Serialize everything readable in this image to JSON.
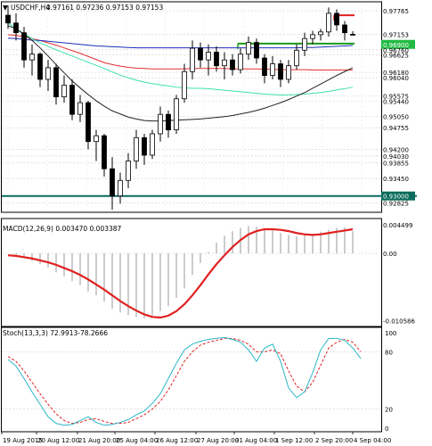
{
  "header": {
    "symbol": "USDCHF,H4",
    "ohlc": "0.97161 0.97236 0.97153 0.97153"
  },
  "colors": {
    "bull_candle": "#ffffff",
    "bear_candle": "#000000",
    "ma_red": "#e53030",
    "ma_blue": "#1a2fb8",
    "ma_cyan": "#3ee0b0",
    "ma_black": "#222222",
    "support_level": "#0b6b5c",
    "resistance_green": "#1a9a1a",
    "resistance_red": "#e02020",
    "macd_signal": "#e02020",
    "macd_hist": "#9a9a9a",
    "stoch_main": "#2ab6c8",
    "stoch_signal": "#e02020",
    "price_tag_fill": "#22bb44",
    "price_tag_dark": "#0b6b5c"
  },
  "chart_data": [
    {
      "type": "candlestick",
      "title": "USDCHF,H4",
      "x_tick_labels": [
        "19 Aug 2015",
        "20 Aug 12:00",
        "21 Aug 20:00",
        "25 Aug 04:00",
        "26 Aug 12:00",
        "27 Aug 20:00",
        "31 Aug 04:00",
        "1 Sep 12:00",
        "2 Sep 20:00",
        "4 Sep 04:00"
      ],
      "y_price_labels": [
        "0.97765",
        "0.97153",
        "0.96900",
        "0.96760",
        "0.96625",
        "0.96180",
        "0.96040",
        "0.95575",
        "0.95440",
        "0.95050",
        "0.94755",
        "0.94200",
        "0.94030",
        "0.93855",
        "0.93450",
        "0.93000",
        "0.92825"
      ],
      "ylim": [
        0.9258,
        0.9795
      ],
      "candles": [
        {
          "o": 0.9765,
          "h": 0.979,
          "l": 0.973,
          "c": 0.9745
        },
        {
          "o": 0.9745,
          "h": 0.977,
          "l": 0.97,
          "c": 0.972
        },
        {
          "o": 0.972,
          "h": 0.9735,
          "l": 0.963,
          "c": 0.965
        },
        {
          "o": 0.965,
          "h": 0.969,
          "l": 0.961,
          "c": 0.9665
        },
        {
          "o": 0.9665,
          "h": 0.967,
          "l": 0.958,
          "c": 0.96
        },
        {
          "o": 0.96,
          "h": 0.965,
          "l": 0.957,
          "c": 0.963
        },
        {
          "o": 0.963,
          "h": 0.964,
          "l": 0.9535,
          "c": 0.9555
        },
        {
          "o": 0.9555,
          "h": 0.961,
          "l": 0.954,
          "c": 0.9585
        },
        {
          "o": 0.9585,
          "h": 0.96,
          "l": 0.9495,
          "c": 0.951
        },
        {
          "o": 0.951,
          "h": 0.956,
          "l": 0.949,
          "c": 0.954
        },
        {
          "o": 0.954,
          "h": 0.9545,
          "l": 0.942,
          "c": 0.944
        },
        {
          "o": 0.944,
          "h": 0.947,
          "l": 0.939,
          "c": 0.9455
        },
        {
          "o": 0.9455,
          "h": 0.946,
          "l": 0.935,
          "c": 0.937
        },
        {
          "o": 0.937,
          "h": 0.94,
          "l": 0.9265,
          "c": 0.93
        },
        {
          "o": 0.93,
          "h": 0.936,
          "l": 0.928,
          "c": 0.934
        },
        {
          "o": 0.934,
          "h": 0.941,
          "l": 0.932,
          "c": 0.939
        },
        {
          "o": 0.939,
          "h": 0.947,
          "l": 0.937,
          "c": 0.945
        },
        {
          "o": 0.945,
          "h": 0.946,
          "l": 0.938,
          "c": 0.9405
        },
        {
          "o": 0.9405,
          "h": 0.947,
          "l": 0.9395,
          "c": 0.946
        },
        {
          "o": 0.946,
          "h": 0.953,
          "l": 0.944,
          "c": 0.951
        },
        {
          "o": 0.951,
          "h": 0.952,
          "l": 0.945,
          "c": 0.947
        },
        {
          "o": 0.947,
          "h": 0.956,
          "l": 0.946,
          "c": 0.955
        },
        {
          "o": 0.955,
          "h": 0.964,
          "l": 0.954,
          "c": 0.962
        },
        {
          "o": 0.962,
          "h": 0.97,
          "l": 0.96,
          "c": 0.968
        },
        {
          "o": 0.968,
          "h": 0.9695,
          "l": 0.963,
          "c": 0.965
        },
        {
          "o": 0.965,
          "h": 0.969,
          "l": 0.961,
          "c": 0.967
        },
        {
          "o": 0.967,
          "h": 0.9685,
          "l": 0.962,
          "c": 0.9635
        },
        {
          "o": 0.9635,
          "h": 0.967,
          "l": 0.96,
          "c": 0.965
        },
        {
          "o": 0.965,
          "h": 0.9665,
          "l": 0.961,
          "c": 0.9625
        },
        {
          "o": 0.9625,
          "h": 0.968,
          "l": 0.9615,
          "c": 0.9665
        },
        {
          "o": 0.9665,
          "h": 0.971,
          "l": 0.965,
          "c": 0.9695
        },
        {
          "o": 0.9695,
          "h": 0.9705,
          "l": 0.964,
          "c": 0.9655
        },
        {
          "o": 0.9655,
          "h": 0.9665,
          "l": 0.959,
          "c": 0.961
        },
        {
          "o": 0.961,
          "h": 0.966,
          "l": 0.96,
          "c": 0.964
        },
        {
          "o": 0.964,
          "h": 0.965,
          "l": 0.958,
          "c": 0.96
        },
        {
          "o": 0.96,
          "h": 0.965,
          "l": 0.959,
          "c": 0.9635
        },
        {
          "o": 0.9635,
          "h": 0.969,
          "l": 0.9625,
          "c": 0.9675
        },
        {
          "o": 0.9675,
          "h": 0.972,
          "l": 0.966,
          "c": 0.9705
        },
        {
          "o": 0.9705,
          "h": 0.9725,
          "l": 0.969,
          "c": 0.9715
        },
        {
          "o": 0.9715,
          "h": 0.973,
          "l": 0.97,
          "c": 0.9722
        },
        {
          "o": 0.9722,
          "h": 0.9785,
          "l": 0.971,
          "c": 0.977
        },
        {
          "o": 0.977,
          "h": 0.978,
          "l": 0.9725,
          "c": 0.974
        },
        {
          "o": 0.974,
          "h": 0.975,
          "l": 0.97,
          "c": 0.972
        },
        {
          "o": 0.9716,
          "h": 0.9724,
          "l": 0.9715,
          "c": 0.9715
        }
      ],
      "moving_averages": [
        {
          "color_key": "ma_red",
          "values": [
            0.9715,
            0.9713,
            0.971,
            0.9705,
            0.97,
            0.9694,
            0.9688,
            0.9681,
            0.9674,
            0.9667,
            0.9659,
            0.9651,
            0.9643,
            0.9638,
            0.9634,
            0.9631,
            0.9629,
            0.9628,
            0.9627,
            0.9627,
            0.9627,
            0.9627,
            0.9627,
            0.9628,
            0.9628,
            0.9628,
            0.9628,
            0.9628,
            0.9627,
            0.9627,
            0.9627,
            0.9627,
            0.9626,
            0.9626,
            0.9625,
            0.9625,
            0.9625,
            0.9625,
            0.9624,
            0.9624,
            0.9624,
            0.9624,
            0.9624,
            0.9624
          ]
        },
        {
          "color_key": "ma_blue",
          "values": [
            0.9706,
            0.9705,
            0.9703,
            0.9701,
            0.97,
            0.9698,
            0.9696,
            0.9694,
            0.9692,
            0.969,
            0.9688,
            0.9686,
            0.9685,
            0.9684,
            0.9683,
            0.9682,
            0.9681,
            0.9681,
            0.9681,
            0.9681,
            0.9681,
            0.9681,
            0.9681,
            0.9681,
            0.9681,
            0.9681,
            0.9681,
            0.9681,
            0.9681,
            0.9681,
            0.9681,
            0.9681,
            0.9681,
            0.9681,
            0.9681,
            0.9681,
            0.9681,
            0.9682,
            0.9682,
            0.9683,
            0.9684,
            0.9685,
            0.9686,
            0.9687
          ]
        },
        {
          "color_key": "ma_cyan",
          "values": [
            0.9745,
            0.973,
            0.9718,
            0.9705,
            0.9694,
            0.9685,
            0.9676,
            0.9668,
            0.966,
            0.9652,
            0.9644,
            0.9636,
            0.9628,
            0.9619,
            0.9611,
            0.9604,
            0.9598,
            0.9593,
            0.9589,
            0.9586,
            0.9583,
            0.958,
            0.9578,
            0.9577,
            0.9577,
            0.9576,
            0.9574,
            0.9572,
            0.957,
            0.9568,
            0.9566,
            0.9564,
            0.9562,
            0.9561,
            0.956,
            0.956,
            0.9561,
            0.9562,
            0.9564,
            0.9566,
            0.9569,
            0.9573,
            0.9576,
            0.958
          ]
        },
        {
          "color_key": "ma_black",
          "values": [
            0.9738,
            0.973,
            0.9716,
            0.97,
            0.9681,
            0.966,
            0.9638,
            0.9617,
            0.9596,
            0.9578,
            0.9561,
            0.9545,
            0.9531,
            0.9519,
            0.9511,
            0.9503,
            0.9498,
            0.9494,
            0.9493,
            0.9493,
            0.9494,
            0.9495,
            0.9496,
            0.9497,
            0.9498,
            0.95,
            0.9502,
            0.9504,
            0.9507,
            0.9511,
            0.9515,
            0.952,
            0.9526,
            0.9533,
            0.954,
            0.9548,
            0.9557,
            0.9566,
            0.9577,
            0.9588,
            0.9599,
            0.961,
            0.962,
            0.963
          ]
        }
      ],
      "horizontal_levels": [
        {
          "price": 0.93,
          "color_key": "support_level",
          "width": 2,
          "from_index": 0,
          "to_index": 43
        },
        {
          "price": 0.9692,
          "color_key": "resistance_green",
          "width": 2,
          "from_index": 29,
          "to_index": 43
        },
        {
          "price": 0.9765,
          "color_key": "resistance_red",
          "width": 2,
          "from_index": 41,
          "to_index": 43
        }
      ],
      "highlighted_price_tags": [
        {
          "label": "0.96900",
          "style": "green"
        },
        {
          "label": "0.93000",
          "style": "dark"
        }
      ]
    },
    {
      "type": "line+histogram",
      "title": "MACD(12,26,9) 0.003470 0.003387",
      "y_tick_labels": [
        "0.004499",
        "0.00",
        "-0.010586"
      ],
      "ylim": [
        -0.0115,
        0.0052
      ],
      "histogram": [
        0.0,
        -0.0002,
        -0.0007,
        -0.0012,
        -0.0017,
        -0.0022,
        -0.003,
        -0.0036,
        -0.0044,
        -0.005,
        -0.006,
        -0.0066,
        -0.0076,
        -0.0087,
        -0.0093,
        -0.0097,
        -0.01,
        -0.0102,
        -0.0098,
        -0.0091,
        -0.0083,
        -0.007,
        -0.0055,
        -0.0034,
        -0.0015,
        0.0002,
        0.0017,
        0.0028,
        0.0035,
        0.004,
        0.0043,
        0.0042,
        0.0039,
        0.0036,
        0.0032,
        0.0029,
        0.0027,
        0.0029,
        0.0031,
        0.0034,
        0.0037,
        0.004,
        0.0041,
        0.0035
      ],
      "signal": [
        -0.0003,
        -0.0004,
        -0.0006,
        -0.0008,
        -0.0011,
        -0.0014,
        -0.0018,
        -0.0023,
        -0.0028,
        -0.0034,
        -0.0041,
        -0.0049,
        -0.0057,
        -0.0066,
        -0.0075,
        -0.0083,
        -0.009,
        -0.0096,
        -0.01,
        -0.0101,
        -0.0098,
        -0.0091,
        -0.008,
        -0.0066,
        -0.005,
        -0.0033,
        -0.0017,
        -0.0003,
        0.001,
        0.0021,
        0.003,
        0.0035,
        0.0038,
        0.0038,
        0.0037,
        0.0035,
        0.0032,
        0.003,
        0.0029,
        0.003,
        0.0032,
        0.0034,
        0.0036,
        0.0038
      ]
    },
    {
      "type": "line",
      "title": "Stoch(13,3,3) 72.9913-78.2666",
      "y_tick_labels": [
        "100",
        "80",
        "20",
        "0"
      ],
      "ylim": [
        0,
        100
      ],
      "levels": [
        80,
        20
      ],
      "main": [
        72,
        65,
        52,
        38,
        25,
        12,
        5,
        3,
        4,
        8,
        12,
        6,
        3,
        4,
        6,
        9,
        14,
        18,
        26,
        36,
        52,
        68,
        82,
        88,
        91,
        93,
        94,
        95,
        93,
        90,
        82,
        70,
        84,
        88,
        70,
        42,
        32,
        38,
        58,
        82,
        94,
        94,
        92,
        84,
        73
      ],
      "signal": [
        75,
        70,
        60,
        48,
        36,
        25,
        15,
        8,
        5,
        6,
        9,
        10,
        7,
        5,
        5,
        6,
        10,
        14,
        20,
        28,
        40,
        55,
        70,
        80,
        87,
        90,
        92,
        94,
        94,
        92,
        88,
        80,
        80,
        82,
        78,
        60,
        44,
        38,
        48,
        66,
        84,
        90,
        93,
        90,
        80
      ]
    }
  ]
}
